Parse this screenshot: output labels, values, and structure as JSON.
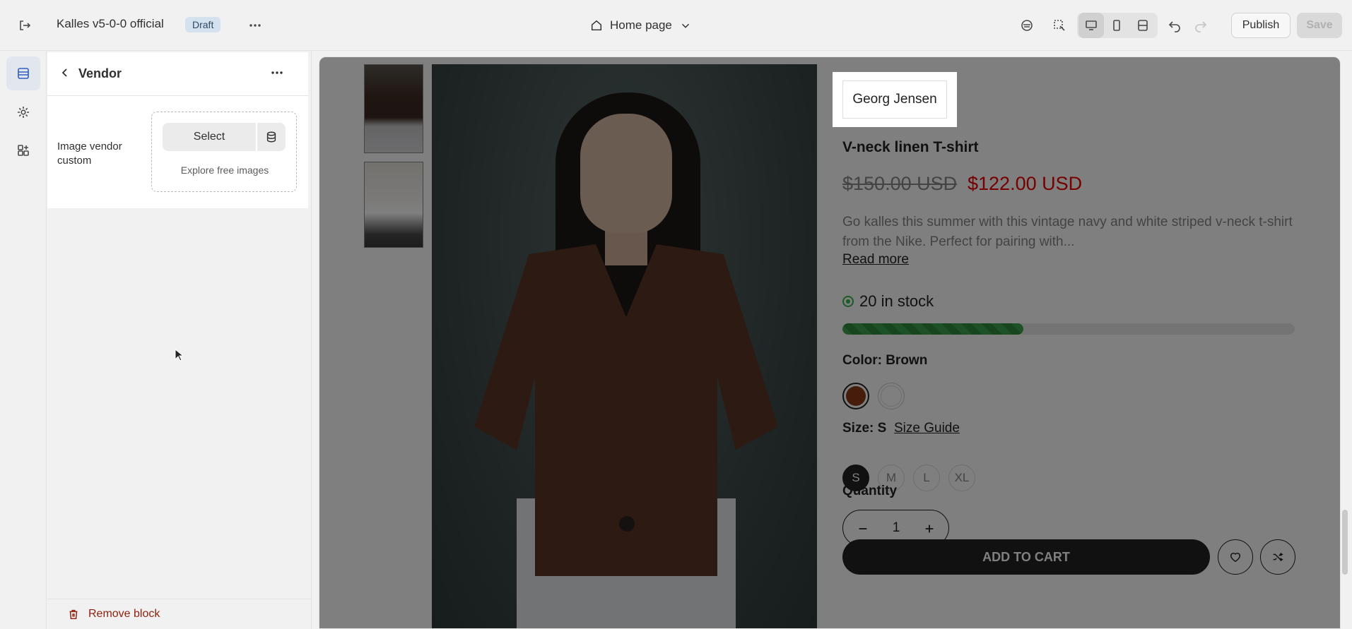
{
  "topbar": {
    "store_name": "Kalles v5-0-0 official",
    "status_badge": "Draft",
    "page_selector": "Home page",
    "publish_label": "Publish",
    "save_label": "Save"
  },
  "panel": {
    "title": "Vendor",
    "field_label": "Image vendor custom",
    "select_label": "Select",
    "explore_label": "Explore free images",
    "remove_label": "Remove block"
  },
  "product": {
    "vendor": "Georg Jensen",
    "title": "V-neck linen T-shirt",
    "price_old": "$150.00 USD",
    "price_new": "$122.00 USD",
    "description": "Go kalles this summer with this vintage navy and white striped v-neck t-shirt from the Nike. Perfect for pairing with...",
    "read_more": "Read more",
    "stock_text": "20 in stock",
    "stock_fraction": 0.4,
    "color_label": "Color: Brown",
    "size_label": "Size: S",
    "size_guide": "Size Guide",
    "sizes": [
      "S",
      "M",
      "L",
      "XL"
    ],
    "quantity_label": "Quantity",
    "quantity_value": "1",
    "add_to_cart": "ADD TO CART"
  },
  "colors": {
    "accent": "#3060c0",
    "price_sale": "#ec0101",
    "stock_bar": "#3fa34d",
    "remove": "#8e1f0b"
  }
}
